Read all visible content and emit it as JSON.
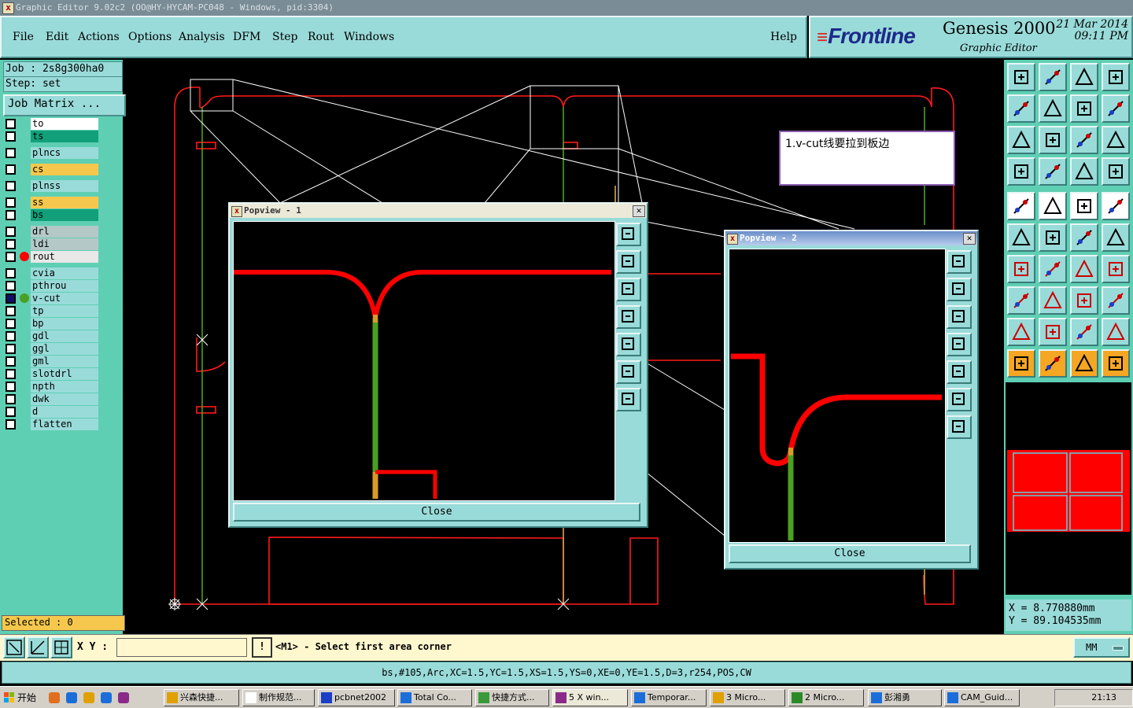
{
  "window": {
    "title": "Graphic Editor 9.02c2  (OO@HY-HYCAM-PC048 - Windows, pid:3304)"
  },
  "menu": [
    "File",
    "Edit",
    "Actions",
    "Options",
    "Analysis",
    "DFM",
    "Step",
    "Rout",
    "Windows"
  ],
  "help_label": "Help",
  "brand": {
    "logo": "Frontline",
    "product": "Genesis 2000",
    "subtitle": "Graphic Editor",
    "date": "21 Mar 2014",
    "time": "09:11 PM"
  },
  "job": {
    "job_label": "Job : 2s8g300ha0",
    "step_label": "Step: set",
    "matrix_button": "Job Matrix ..."
  },
  "layers": [
    {
      "name": "to",
      "color": "#ffffff"
    },
    {
      "name": "ts",
      "color": "#11a07a"
    },
    {
      "name": "plncs",
      "color": "#99dbd9"
    },
    {
      "name": "cs",
      "color": "#f5c84d"
    },
    {
      "name": "plnss",
      "color": "#99dbd9"
    },
    {
      "name": "ss",
      "color": "#f5c84d"
    },
    {
      "name": "bs",
      "color": "#11a07a"
    },
    {
      "name": "drl",
      "color": "#b4c8c8"
    },
    {
      "name": "ldi",
      "color": "#b4c8c8"
    },
    {
      "name": "rout",
      "color": "#e8e8e8",
      "marker": "#ff0000"
    },
    {
      "name": "cvia",
      "color": "#99dbd9"
    },
    {
      "name": "pthrou",
      "color": "#99dbd9"
    },
    {
      "name": "v-cut",
      "color": "#99dbd9",
      "marker": "#4aa020",
      "work": true
    },
    {
      "name": "tp",
      "color": "#99dbd9"
    },
    {
      "name": "bp",
      "color": "#99dbd9"
    },
    {
      "name": "gdl",
      "color": "#99dbd9"
    },
    {
      "name": "ggl",
      "color": "#99dbd9"
    },
    {
      "name": "gml",
      "color": "#99dbd9"
    },
    {
      "name": "slotdrl",
      "color": "#99dbd9"
    },
    {
      "name": "npth",
      "color": "#99dbd9"
    },
    {
      "name": "dwk",
      "color": "#99dbd9"
    },
    {
      "name": "d",
      "color": "#99dbd9"
    },
    {
      "name": "flatten",
      "color": "#99dbd9"
    }
  ],
  "selected": "Selected : 0",
  "popview1": {
    "title": "Popview - 1",
    "close": "Close"
  },
  "popview2": {
    "title": "Popview - 2",
    "close": "Close"
  },
  "note": "1.v-cut线要拉到板边",
  "coords": {
    "x": "X  =  8.770880mm",
    "y": "Y  =  89.104535mm"
  },
  "command": {
    "xy_label": "X Y :",
    "xy_value": "",
    "prompt_icon": "!",
    "prompt": "<M1> - Select first area corner",
    "units": "MM"
  },
  "status_line": "bs,#105,Arc,XC=1.5,YC=1.5,XS=1.5,YS=0,XE=0,YE=1.5,D=3,r254,POS,CW",
  "taskbar": {
    "start": "开始",
    "tasks": [
      "兴森快捷...",
      "制作规范...",
      "pcbnet2002",
      "Total Co...",
      "快捷方式...",
      "5 X win...",
      "Temporar...",
      "3 Micro...",
      "2 Micro...",
      "彭湘勇",
      "CAM_Guid..."
    ],
    "clock": "21:13"
  },
  "colors": {
    "panel": "#99dbd9",
    "panel_bg": "#5fcfb3",
    "rout": "#ff0000",
    "vcut": "#4aa020"
  }
}
